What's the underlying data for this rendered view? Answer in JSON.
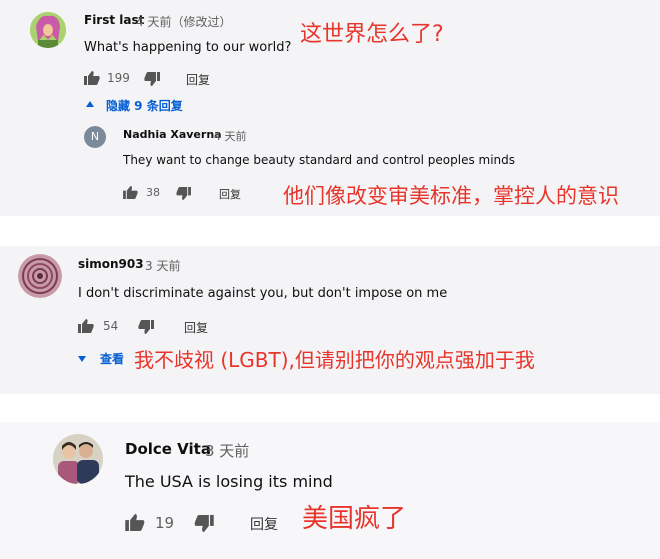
{
  "comments": [
    {
      "author": "First last",
      "time": "4 天前（修改过）",
      "text": "What's happening to our world?",
      "likes": "199",
      "reply_label": "回复",
      "toggle_label": "隐藏 9 条回复",
      "annotation": "这世界怎么了?",
      "reply": {
        "avatar_letter": "N",
        "author": "Nadhia Xaverna",
        "time": "4 天前",
        "text": "They want to change beauty standard and control peoples minds",
        "likes": "38",
        "reply_label": "回复",
        "annotation": "他们像改变审美标准，掌控人的意识"
      }
    },
    {
      "author": "simon903",
      "time": "3 天前",
      "text": "I don't discriminate against you, but don't impose on me",
      "likes": "54",
      "reply_label": "回复",
      "toggle_label": "查看",
      "annotation": "我不歧视 (LGBT),但请别把你的观点强加于我"
    },
    {
      "author": "Dolce Vita",
      "time": "3 天前",
      "text": "The USA is losing its mind",
      "likes": "19",
      "reply_label": "回复",
      "annotation": "美国疯了"
    }
  ],
  "colors": {
    "card_bg": "#f4f4f6",
    "annotation": "#e8352b",
    "toggle": "#065fd4",
    "reply_avatar": "#7a8a9a"
  },
  "icons": [
    "thumb-up-icon",
    "thumb-down-icon",
    "caret-up-icon",
    "caret-down-icon"
  ]
}
